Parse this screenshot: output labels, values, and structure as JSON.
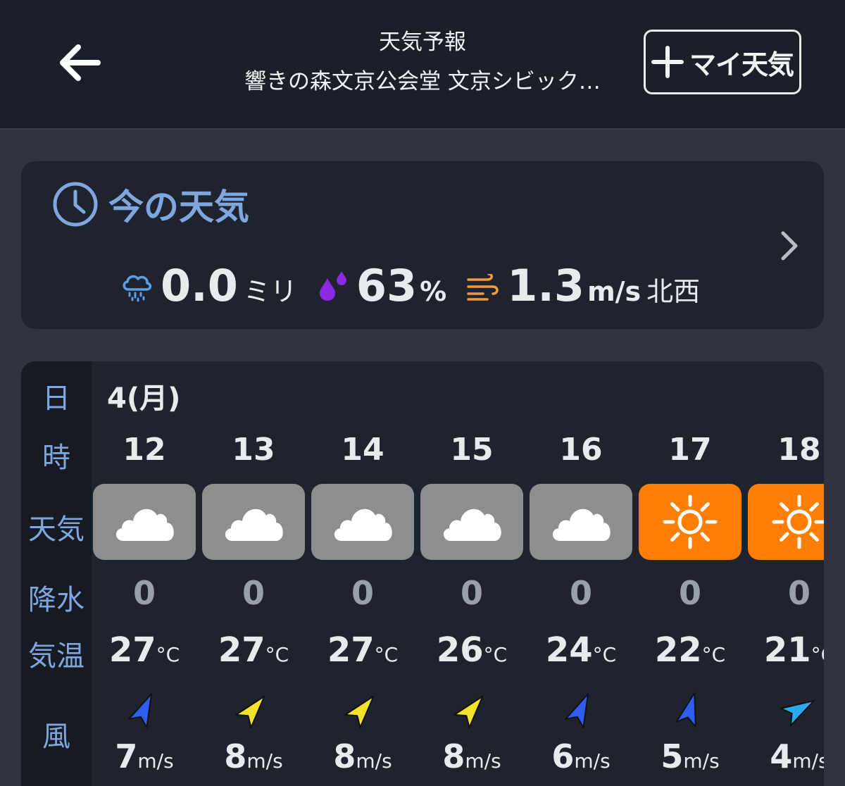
{
  "header": {
    "title": "天気予報",
    "subtitle": "響きの森文京公会堂 文京シビック…",
    "my_weather_label": "マイ天気"
  },
  "now": {
    "title": "今の天気",
    "precip_value": "0.0",
    "precip_unit": "ミリ",
    "humidity_value": "63",
    "humidity_unit": "%",
    "wind_value": "1.3",
    "wind_unit": "m/s",
    "wind_dir": "北西"
  },
  "table": {
    "labels": {
      "day": "日",
      "hour": "時",
      "weather": "天気",
      "precip": "降水",
      "temp": "気温",
      "wind": "風"
    },
    "date": "4(月)",
    "temp_unit": "°C",
    "wind_unit": "m/s",
    "hours": [
      {
        "hour": "12",
        "weather": "cloudy",
        "precip": "0",
        "temp": "27",
        "wind": "7",
        "wind_color": "#2f5df0",
        "wind_rotation": 25
      },
      {
        "hour": "13",
        "weather": "cloudy",
        "precip": "0",
        "temp": "27",
        "wind": "8",
        "wind_color": "#f2e22a",
        "wind_rotation": 40
      },
      {
        "hour": "14",
        "weather": "cloudy",
        "precip": "0",
        "temp": "27",
        "wind": "8",
        "wind_color": "#f2e22a",
        "wind_rotation": 40
      },
      {
        "hour": "15",
        "weather": "cloudy",
        "precip": "0",
        "temp": "26",
        "wind": "8",
        "wind_color": "#f2e22a",
        "wind_rotation": 40
      },
      {
        "hour": "16",
        "weather": "cloudy",
        "precip": "0",
        "temp": "24",
        "wind": "6",
        "wind_color": "#2f5df0",
        "wind_rotation": 25
      },
      {
        "hour": "17",
        "weather": "sunny",
        "precip": "0",
        "temp": "22",
        "wind": "5",
        "wind_color": "#2f5df0",
        "wind_rotation": 15
      },
      {
        "hour": "18",
        "weather": "sunny",
        "precip": "0",
        "temp": "21",
        "wind": "4",
        "wind_color": "#2aa8f0",
        "wind_rotation": 60
      }
    ]
  },
  "colors": {
    "accent_blue": "#7fa7de",
    "cloudy_tile": "#8e8e90",
    "sunny_tile": "#ff7d00",
    "humidity_icon": "#8a2be2",
    "wind_icon": "#f59a3a"
  },
  "icons": {
    "back": "arrow-left-icon",
    "add": "plus-icon",
    "clock": "clock-icon",
    "rain": "rain-cloud-icon",
    "humidity": "droplets-icon",
    "wind": "wind-icon",
    "chevron": "chevron-right-icon",
    "cloudy": "cloud-icon",
    "sunny": "sun-icon",
    "wind_dir": "navigation-arrow-icon"
  }
}
